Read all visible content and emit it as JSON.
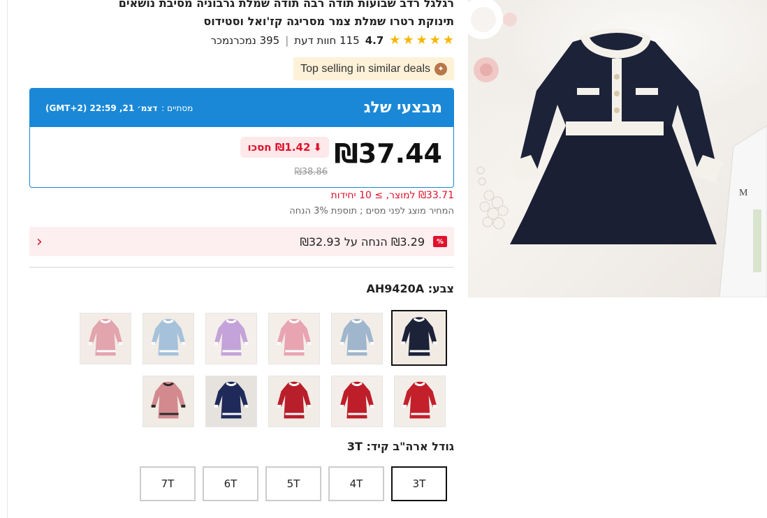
{
  "product": {
    "title_line1": "רגלגל רדב שבועות תודה רבה תודה שמלת גרבוניה מסיבת נושאים",
    "title_line2": "תינוקת רטרו שמלת צמר מסריגה קז'ואל וסטידוס",
    "rating": "4.7",
    "reviews": "115 חוות דעת",
    "sold": "395 נמכרנמכר",
    "top_selling": "Top selling in similar deals"
  },
  "deals": {
    "title": "מבצעי שלג",
    "ends_label": "מסתיים :",
    "ends_value": "דצמ׳ 21, 22:59 (GMT+2)",
    "price": "₪37.44",
    "save": "₪1.42 חסכו",
    "old_price": "₪38.86"
  },
  "pricing": {
    "unit_price": "₪33.71 למוצר, ≥ 10 יחידות",
    "tax_note": "המחיר מוצג לפני מסים ; תוספת 3% הנחה"
  },
  "discount": {
    "badge": "%",
    "text": "₪3.29 הנחה על ₪32.93"
  },
  "color": {
    "label": "צבע: AH9420A",
    "swatches": [
      {
        "name": "navy",
        "dress": "#1c2238",
        "trim": "#ffffff",
        "bg": "#f1ebe4"
      },
      {
        "name": "light-blue",
        "dress": "#9fb6cc",
        "trim": "#ffffff",
        "bg": "#f3ede7"
      },
      {
        "name": "pink",
        "dress": "#e8a5b1",
        "trim": "#ffffff",
        "bg": "#f4eee9"
      },
      {
        "name": "lilac",
        "dress": "#c3a3d9",
        "trim": "#ffffff",
        "bg": "#f4efea"
      },
      {
        "name": "sky",
        "dress": "#a6c1da",
        "trim": "#ffffff",
        "bg": "#f1ece5"
      },
      {
        "name": "rose",
        "dress": "#e2a4ad",
        "trim": "#ffffff",
        "bg": "#f3ece6"
      },
      {
        "name": "red-trim",
        "dress": "#c3202b",
        "trim": "#ffffff",
        "bg": "#f3ede8"
      },
      {
        "name": "red-collar",
        "dress": "#bd1e2a",
        "trim": "#ffffff",
        "bg": "#f4eeea"
      },
      {
        "name": "red-bow",
        "dress": "#b81f2a",
        "trim": "#ffffff",
        "bg": "#f2ece6"
      },
      {
        "name": "reindeer",
        "dress": "#1f2a5a",
        "trim": "#ffffff",
        "bg": "#e6e2dd"
      },
      {
        "name": "floral",
        "dress": "#d28a8f",
        "trim": "#2a2a2a",
        "bg": "#f1ebe5"
      }
    ]
  },
  "size": {
    "label": "גודל ארה\"ב קיד: 3T",
    "options": [
      "3T",
      "4T",
      "5T",
      "6T",
      "7T"
    ],
    "selected": "3T"
  }
}
